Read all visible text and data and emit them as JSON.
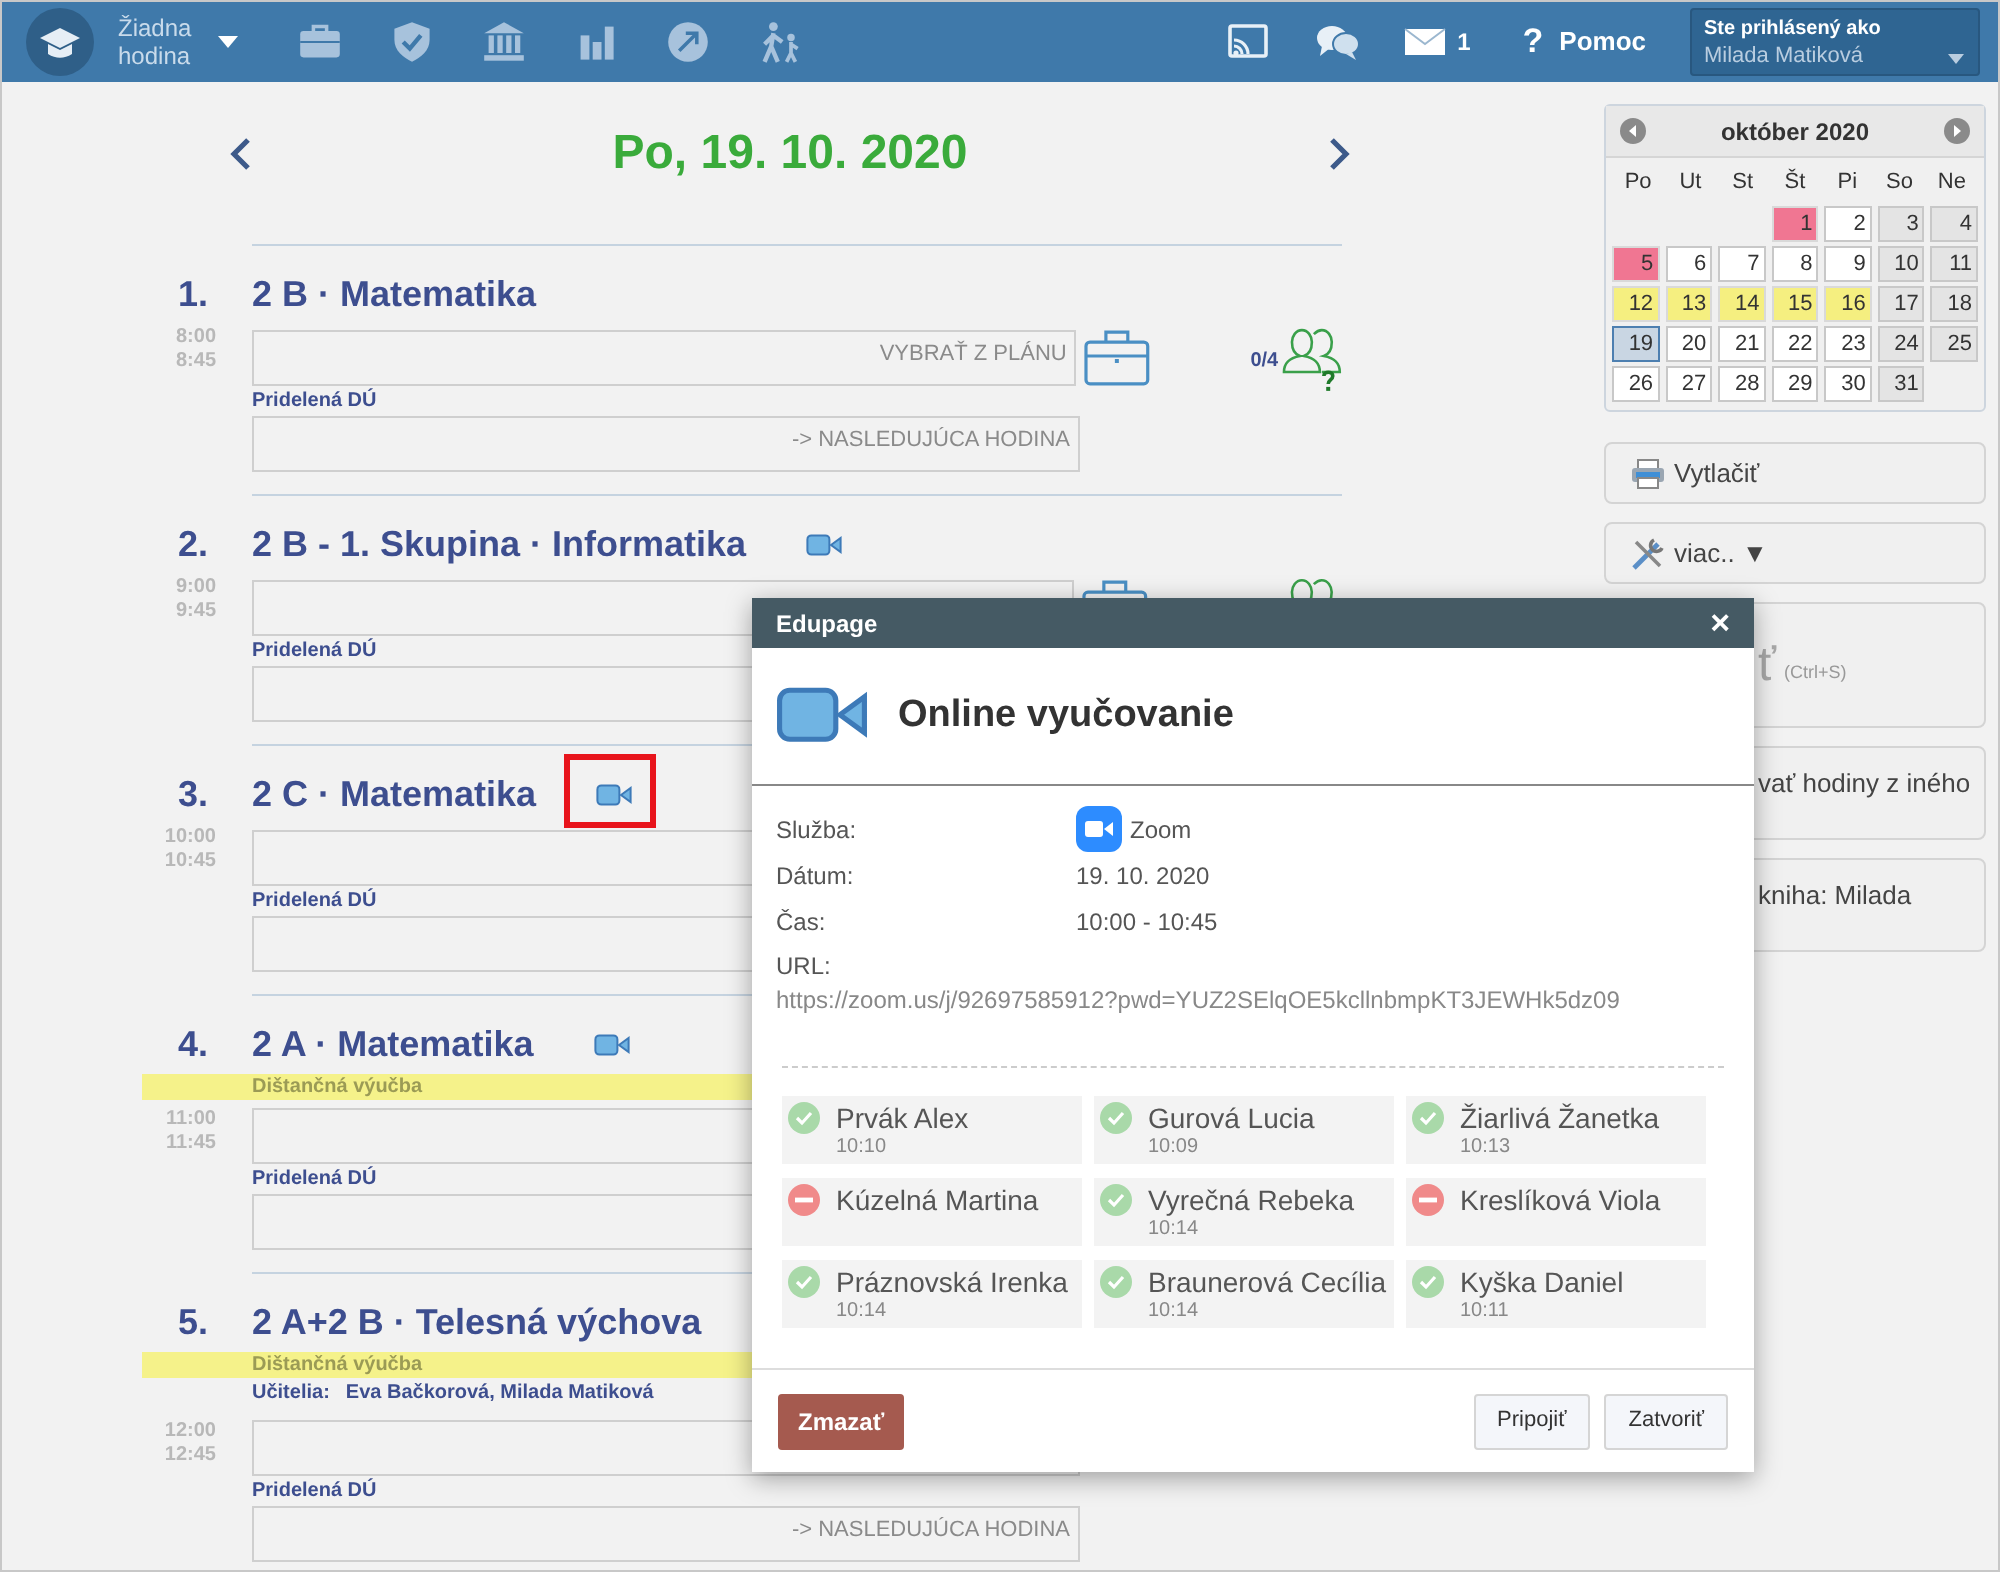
{
  "topbar": {
    "lesson_label": "Žiadna hodina",
    "messages_count": "1",
    "help_glyph": "?",
    "help_label": "Pomoc",
    "user_caption": "Ste prihlásený ako",
    "user_name": "Milada Matiková"
  },
  "date_title": "Po, 19. 10. 2020",
  "lessons": [
    {
      "number": "1.",
      "title": "2 B · Matematika",
      "video": false,
      "highlighted": false,
      "start": "8:00",
      "end": "8:45",
      "plan_text": "VYBRAŤ Z PLÁNU",
      "hw_label": "Pridelená DÚ",
      "hw_text": "-> NASLEDUJÚCA HODINA",
      "tools": true,
      "attendance": "0/4"
    },
    {
      "number": "2.",
      "title": "2 B - 1. Skupina · Informatika",
      "video": true,
      "highlighted": false,
      "start": "9:00",
      "end": "9:45",
      "hw_label": "Pridelená DÚ",
      "tools": true
    },
    {
      "number": "3.",
      "title": "2 C · Matematika",
      "video": true,
      "highlighted": true,
      "start": "10:00",
      "end": "10:45",
      "hw_label": "Pridelená DÚ",
      "tools": false
    },
    {
      "number": "4.",
      "title": "2 A · Matematika",
      "video": true,
      "highlighted": false,
      "distance": "Dištančná výučba",
      "start": "11:00",
      "end": "11:45",
      "hw_label": "Pridelená DÚ",
      "tools": false
    },
    {
      "number": "5.",
      "title": "2 A+2 B · Telesná výchova",
      "video": false,
      "highlighted": false,
      "distance": "Dištančná výučba",
      "teachers_label": "Učitelia:",
      "teachers": "Eva Bačkorová, Milada Matiková",
      "start": "12:00",
      "end": "12:45",
      "hw_label": "Pridelená DÚ",
      "hw_text": "-> NASLEDUJÚCA HODINA",
      "tools": false
    }
  ],
  "calendar": {
    "month": "október 2020",
    "weekdays": [
      "Po",
      "Ut",
      "St",
      "Št",
      "Pi",
      "So",
      "Ne"
    ],
    "weeks": [
      [
        {
          "kind": "empty"
        },
        {
          "kind": "empty"
        },
        {
          "kind": "empty"
        },
        {
          "day": "1",
          "kind": "marked",
          "selected": false
        },
        {
          "day": "2",
          "kind": "normal",
          "selected": false
        },
        {
          "day": "3",
          "kind": "weekend",
          "selected": false
        },
        {
          "day": "4",
          "kind": "weekend",
          "selected": false
        }
      ],
      [
        {
          "day": "5",
          "kind": "marked",
          "selected": false
        },
        {
          "day": "6",
          "kind": "normal",
          "selected": false
        },
        {
          "day": "7",
          "kind": "normal",
          "selected": false
        },
        {
          "day": "8",
          "kind": "normal",
          "selected": false
        },
        {
          "day": "9",
          "kind": "normal",
          "selected": false
        },
        {
          "day": "10",
          "kind": "weekend",
          "selected": false
        },
        {
          "day": "11",
          "kind": "weekend",
          "selected": false
        }
      ],
      [
        {
          "day": "12",
          "kind": "distance",
          "selected": false
        },
        {
          "day": "13",
          "kind": "distance",
          "selected": false
        },
        {
          "day": "14",
          "kind": "distance",
          "selected": false
        },
        {
          "day": "15",
          "kind": "distance",
          "selected": false
        },
        {
          "day": "16",
          "kind": "distance",
          "selected": false
        },
        {
          "day": "17",
          "kind": "weekend",
          "selected": false
        },
        {
          "day": "18",
          "kind": "weekend",
          "selected": false
        }
      ],
      [
        {
          "day": "19",
          "kind": "normal",
          "selected": true
        },
        {
          "day": "20",
          "kind": "normal",
          "selected": false
        },
        {
          "day": "21",
          "kind": "normal",
          "selected": false
        },
        {
          "day": "22",
          "kind": "normal",
          "selected": false
        },
        {
          "day": "23",
          "kind": "normal",
          "selected": false
        },
        {
          "day": "24",
          "kind": "weekend",
          "selected": false
        },
        {
          "day": "25",
          "kind": "weekend",
          "selected": false
        }
      ],
      [
        {
          "day": "26",
          "kind": "normal",
          "selected": false
        },
        {
          "day": "27",
          "kind": "normal",
          "selected": false
        },
        {
          "day": "28",
          "kind": "normal",
          "selected": false
        },
        {
          "day": "29",
          "kind": "normal",
          "selected": false
        },
        {
          "day": "30",
          "kind": "normal",
          "selected": false
        },
        {
          "day": "31",
          "kind": "weekend",
          "selected": false
        },
        {
          "kind": "empty"
        }
      ]
    ]
  },
  "side_buttons": [
    {
      "kind": "print",
      "label": "Vytlačiť"
    },
    {
      "kind": "menu",
      "label": "viac..",
      "caret": "▼"
    },
    {
      "kind": "save",
      "label": "ť",
      "hint": "(Ctrl+S)"
    },
    {
      "kind": "covered",
      "label": "vať hodiny z iného"
    },
    {
      "kind": "covered",
      "label": "kniha: Milada"
    }
  ],
  "dialog": {
    "header": "Edupage",
    "close": "×",
    "title": "Online vyučovanie",
    "details": [
      {
        "kind": "service",
        "label": "Služba:",
        "value": "Zoom"
      },
      {
        "kind": "text",
        "label": "Dátum:",
        "value": "19. 10. 2020"
      },
      {
        "kind": "text",
        "label": "Čas:",
        "value": "10:00 - 10:45"
      },
      {
        "kind": "url",
        "label": "URL:",
        "value": "https://zoom.us/j/92697585912?pwd=YUZ2SElqOE5kcllnbmpKT3JEWHk5dz09"
      }
    ],
    "participants": [
      {
        "name": "Prvák Alex",
        "time": "10:10",
        "present": true
      },
      {
        "name": "Gurová Lucia",
        "time": "10:09",
        "present": true
      },
      {
        "name": "Žiarlivá Žanetka",
        "time": "10:13",
        "present": true
      },
      {
        "name": "Kúzelná Martina",
        "present": false
      },
      {
        "name": "Vyrečná Rebeka",
        "time": "10:14",
        "present": true
      },
      {
        "name": "Kreslíková Viola",
        "present": false
      },
      {
        "name": "Práznovská Irenka",
        "time": "10:14",
        "present": true
      },
      {
        "name": "Braunerová Cecília",
        "time": "10:14",
        "present": true
      },
      {
        "name": "Kyška Daniel",
        "time": "10:11",
        "present": true
      }
    ],
    "buttons": [
      {
        "kind": "danger",
        "label": "Zmazať"
      },
      {
        "kind": "plain",
        "label": "Pripojiť"
      },
      {
        "kind": "plain",
        "label": "Zatvoriť"
      }
    ]
  }
}
